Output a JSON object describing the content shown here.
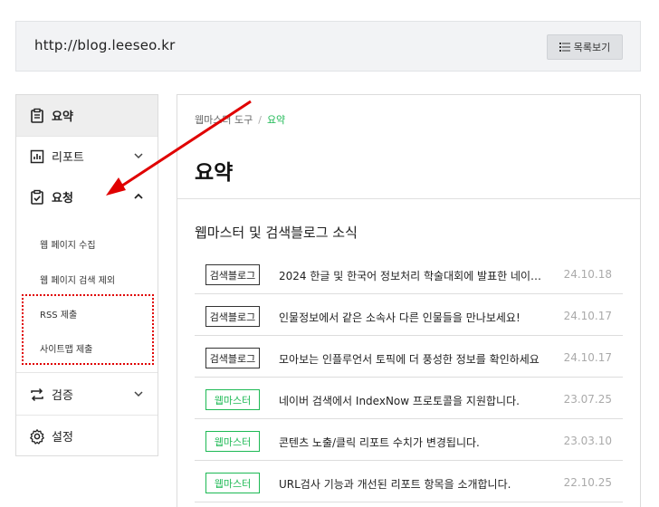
{
  "url_bar": {
    "url": "http://blog.leeseo.kr",
    "list_button_label": "목록보기"
  },
  "sidebar": {
    "items": [
      {
        "label": "요약",
        "icon": "clipboard-icon",
        "active": true
      },
      {
        "label": "리포트",
        "icon": "bar-chart-icon",
        "expandable": true,
        "expanded": false
      },
      {
        "label": "요청",
        "icon": "clipboard-check-icon",
        "expandable": true,
        "expanded": true
      },
      {
        "label": "검증",
        "icon": "swap-arrows-icon",
        "expandable": true,
        "expanded": false
      },
      {
        "label": "설정",
        "icon": "gear-icon"
      }
    ],
    "request_subitems": [
      "웹 페이지 수집",
      "웹 페이지 검색 제외",
      "RSS 제출",
      "사이트맵 제출"
    ]
  },
  "main": {
    "breadcrumb": {
      "parent": "웹마스터 도구",
      "separator": "/",
      "current": "요약"
    },
    "title": "요약",
    "section_title": "웹마스터 및 검색블로그 소식",
    "news": [
      {
        "tag": "검색블로그",
        "tag_style": "dark",
        "title": "2024 한글 및 한국어 정보처리 학술대회에 발표한 네이버의 …",
        "date": "24.10.18"
      },
      {
        "tag": "검색블로그",
        "tag_style": "dark",
        "title": "인물정보에서 같은 소속사 다른 인물들을 만나보세요!",
        "date": "24.10.17"
      },
      {
        "tag": "검색블로그",
        "tag_style": "dark",
        "title": "모아보는 인플루언서 토픽에 더 풍성한 정보를 확인하세요",
        "date": "24.10.17"
      },
      {
        "tag": "웹마스터",
        "tag_style": "green",
        "title": "네이버 검색에서 IndexNow 프로토콜을 지원합니다.",
        "date": "23.07.25"
      },
      {
        "tag": "웹마스터",
        "tag_style": "green",
        "title": "콘텐츠 노출/클릭 리포트 수치가 변경됩니다.",
        "date": "23.03.10"
      },
      {
        "tag": "웹마스터",
        "tag_style": "green",
        "title": "URL검사 기능과 개선된 리포트 항목을 소개합니다.",
        "date": "22.10.25"
      }
    ]
  },
  "colors": {
    "accent_green": "#1db954",
    "annotation_red": "#e00000"
  }
}
